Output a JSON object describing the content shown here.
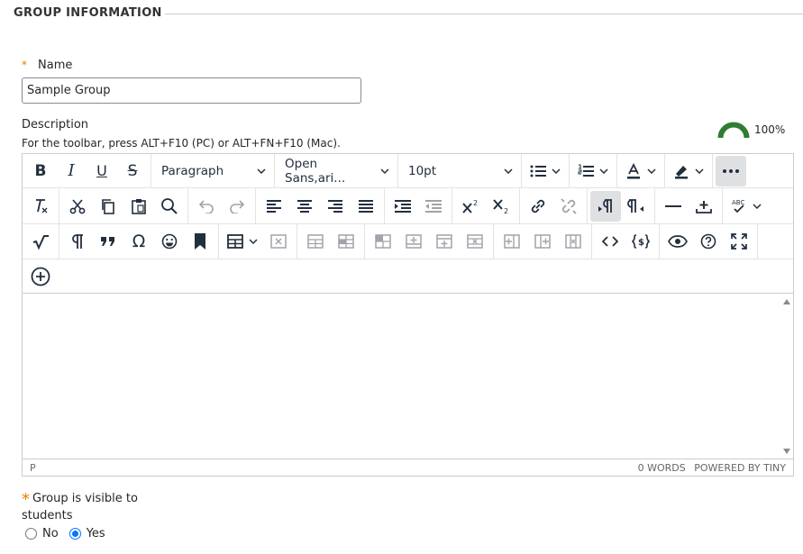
{
  "section": {
    "title": "GROUP INFORMATION"
  },
  "name_field": {
    "required_mark": "*",
    "label": "Name",
    "value": "Sample Group"
  },
  "description": {
    "label": "Description",
    "help": "For the toolbar, press ALT+F10 (PC) or ALT+FN+F10 (Mac).",
    "percent": "100%"
  },
  "toolbar": {
    "bold": "B",
    "italic": "I",
    "underline": "U",
    "strikethrough": "S",
    "block_format": "Paragraph",
    "font_family": "Open Sans,ari...",
    "font_size": "10pt",
    "special_char": "Ω"
  },
  "status": {
    "path": "P",
    "words": "0 WORDS",
    "powered": "POWERED BY TINY"
  },
  "visibility": {
    "required_mark": "*",
    "label": "Group is visible to students",
    "options": [
      {
        "label": "No",
        "checked": false
      },
      {
        "label": "Yes",
        "checked": true
      }
    ]
  },
  "colors": {
    "required": "#e87b00",
    "gauge": "#2e7d32",
    "radio": "#0075ff"
  }
}
